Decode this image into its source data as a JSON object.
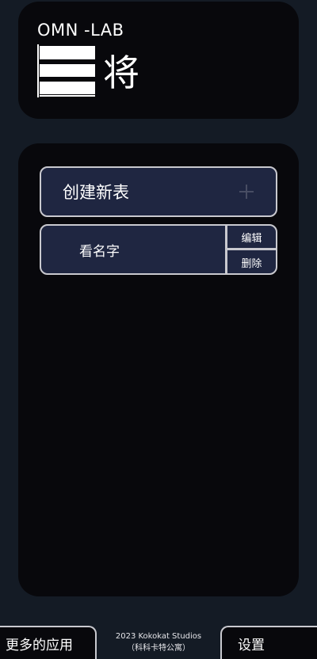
{
  "header": {
    "brand_sub": "OMN -LAB",
    "brand_title": "将",
    "logo_icon": "three-bars-logo-icon"
  },
  "main": {
    "create_label": "创建新表",
    "items": [
      {
        "name": "看名字",
        "edit_label": "编辑",
        "delete_label": "删除"
      }
    ]
  },
  "footer": {
    "more_apps_label": "更多的应用",
    "settings_label": "设置",
    "credit_line1": "2023 Kokokat Studios",
    "credit_line2": "（科科卡特公寓）"
  },
  "colors": {
    "background": "#141b25",
    "card": "#08080c",
    "button": "#1f2641",
    "border": "#c9c9cf",
    "text": "#ffffff"
  }
}
